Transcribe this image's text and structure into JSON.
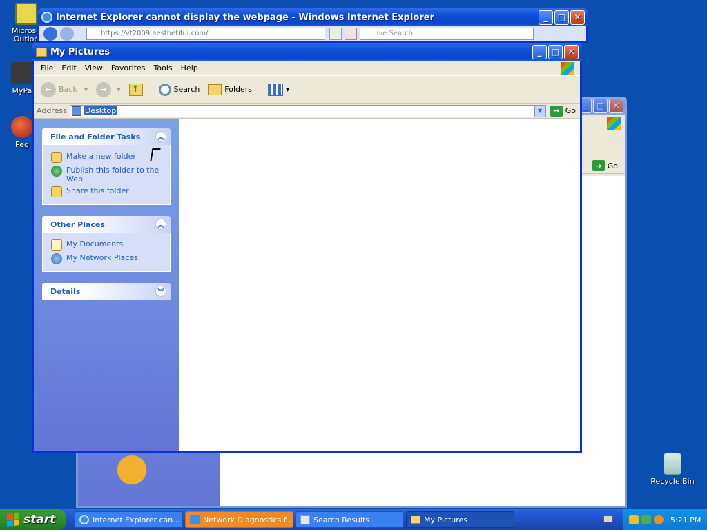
{
  "desktop": {
    "icons": [
      {
        "label": "Microsoft Outlook",
        "display": "Microso\nOutloo"
      },
      {
        "label": "MyPa"
      },
      {
        "label": "Peg"
      },
      {
        "label": "Recycle Bin"
      }
    ]
  },
  "ie_window": {
    "title": "Internet Explorer cannot display the webpage - Windows Internet Explorer",
    "url": "https://vt2009.aesthetiful.com/",
    "search_placeholder": "Live Search"
  },
  "back_window": {
    "go_label": "Go"
  },
  "explorer": {
    "title": "My Pictures",
    "menu": [
      "File",
      "Edit",
      "View",
      "Favorites",
      "Tools",
      "Help"
    ],
    "toolbar": {
      "back": "Back",
      "search": "Search",
      "folders": "Folders"
    },
    "address": {
      "label": "Address",
      "value": "Desktop",
      "go": "Go"
    },
    "panels": {
      "tasks": {
        "title": "File and Folder Tasks",
        "items": [
          "Make a new folder",
          "Publish this folder to the Web",
          "Share this folder"
        ]
      },
      "places": {
        "title": "Other Places",
        "items": [
          "My Documents",
          "My Network Places"
        ]
      },
      "details": {
        "title": "Details"
      }
    }
  },
  "taskbar": {
    "start": "start",
    "items": [
      {
        "label": "Internet Explorer can..."
      },
      {
        "label": "Network Diagnostics f..."
      },
      {
        "label": "Search Results"
      },
      {
        "label": "My Pictures"
      }
    ],
    "clock": "5:21 PM"
  },
  "colors": {
    "desktop": "#0a4fb0",
    "titlebar": "#0b4fd6",
    "link": "#215dc6",
    "flash": "#f08a24"
  }
}
